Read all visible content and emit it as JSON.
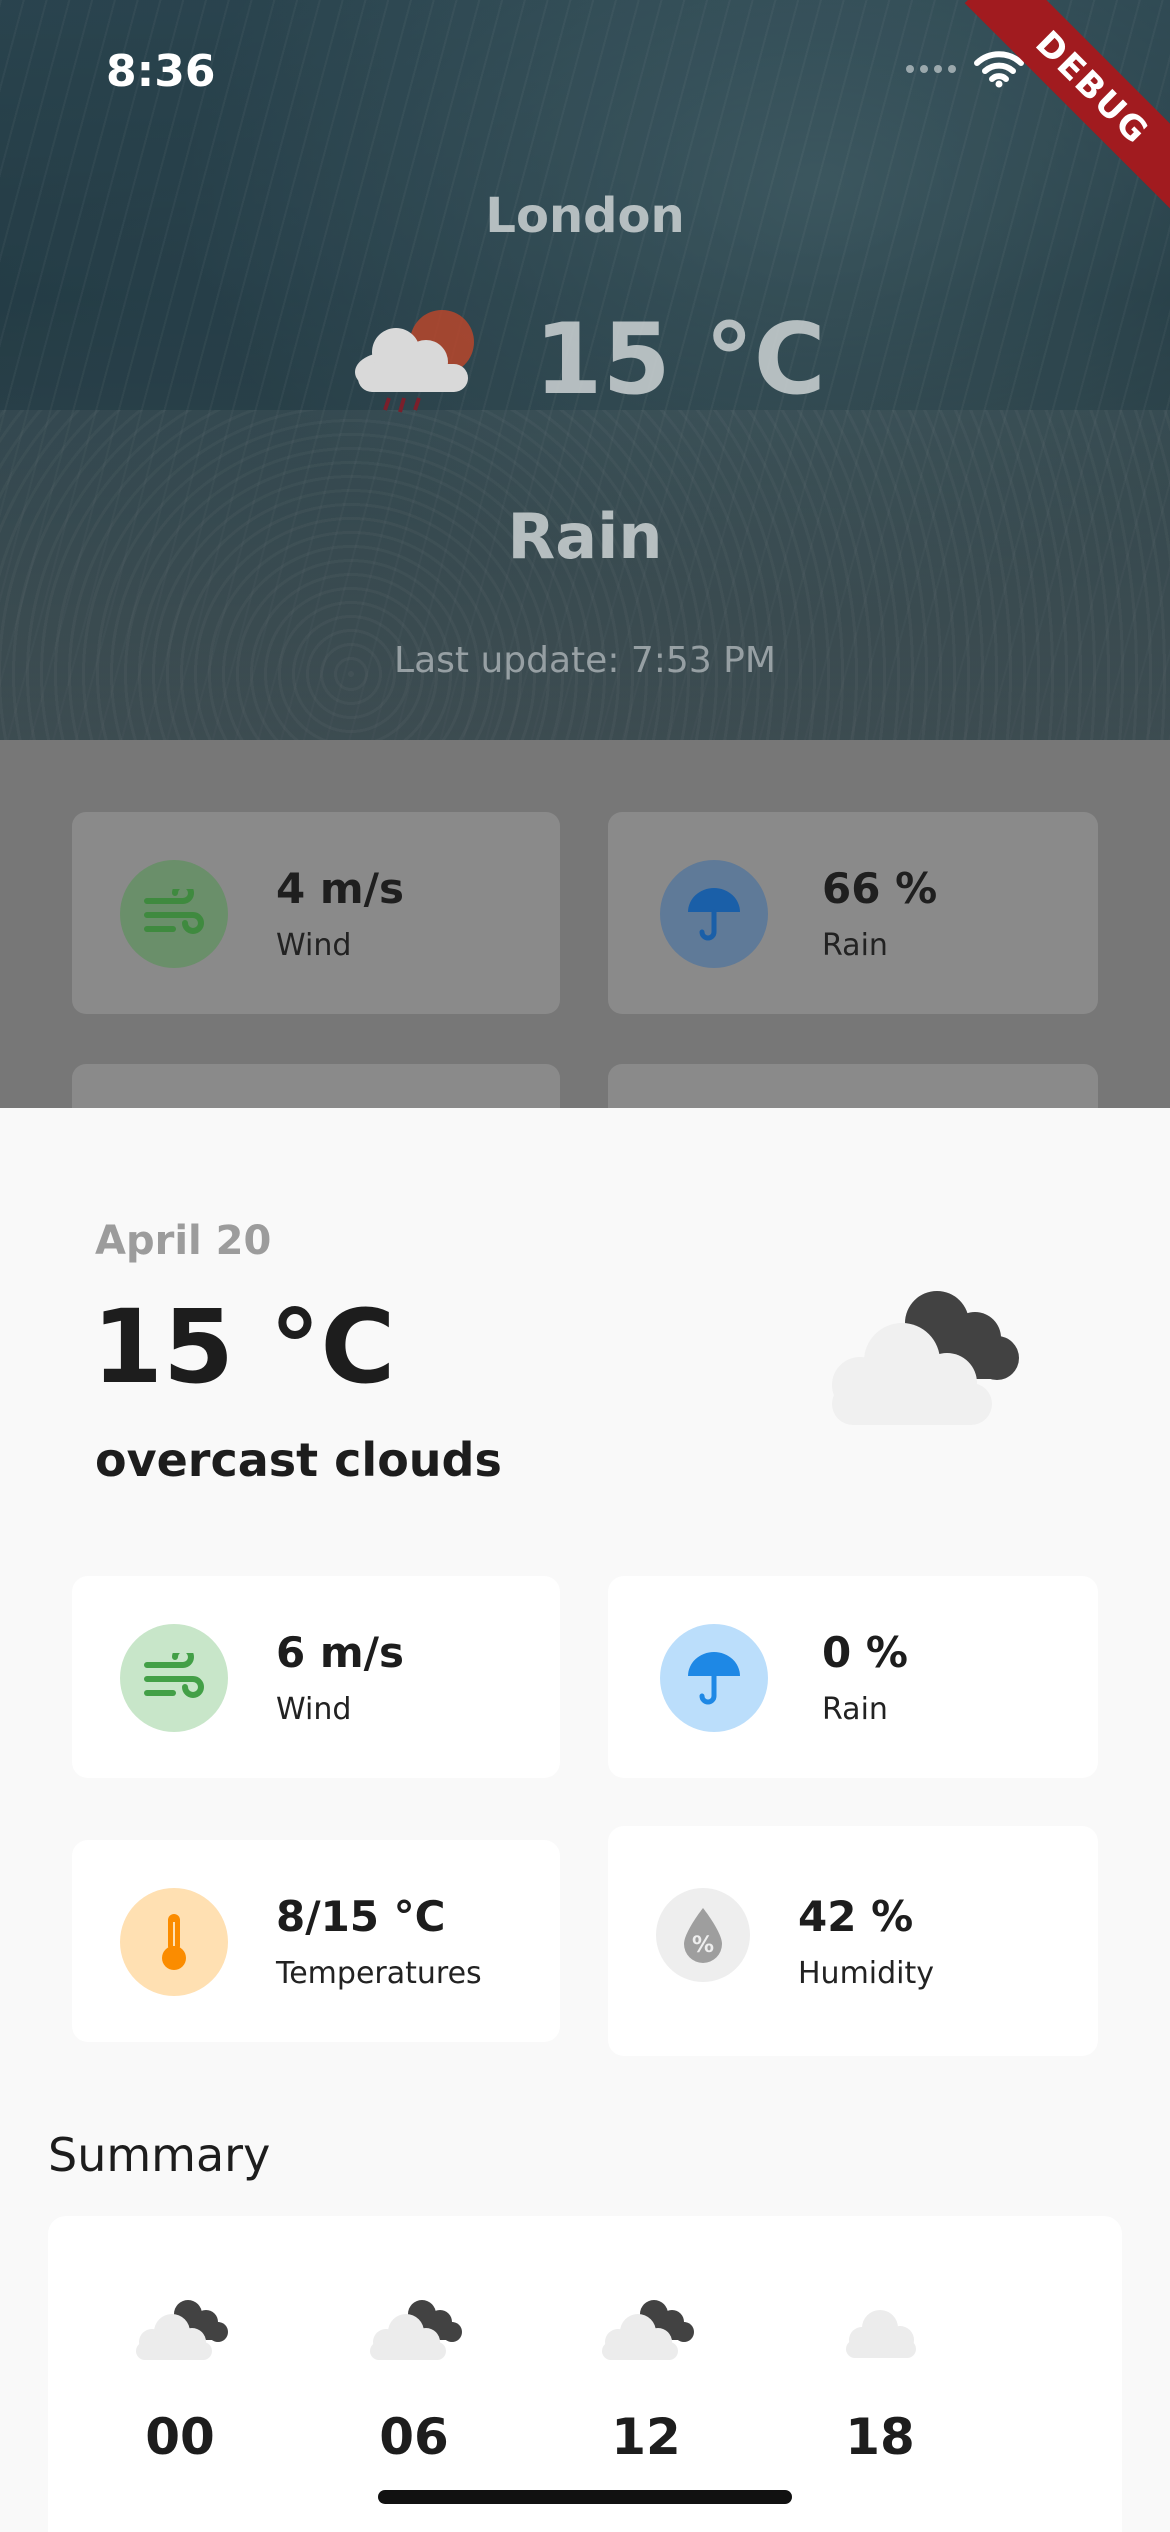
{
  "status_bar": {
    "time": "8:36"
  },
  "debug_banner": "DEBUG",
  "current": {
    "city": "London",
    "temperature": "15 °C",
    "condition": "Rain",
    "last_update": "Last update: 7:53 PM",
    "cards": [
      {
        "value": "4 m/s",
        "label": "Wind",
        "icon": "wind-icon"
      },
      {
        "value": "66 %",
        "label": "Rain",
        "icon": "umbrella-icon"
      }
    ]
  },
  "sheet": {
    "date": "April 20",
    "temperature": "15 °C",
    "description": "overcast clouds",
    "icon": "overcast-clouds-icon",
    "cards": [
      {
        "value": "6 m/s",
        "label": "Wind",
        "icon": "wind-icon"
      },
      {
        "value": "0 %",
        "label": "Rain",
        "icon": "umbrella-icon"
      },
      {
        "value": "8/15 °C",
        "label": "Temperatures",
        "icon": "thermometer-icon"
      },
      {
        "value": "42 %",
        "label": "Humidity",
        "icon": "humidity-icon"
      }
    ],
    "summary_title": "Summary",
    "hours": [
      {
        "hour": "00",
        "icon": "overcast-clouds-icon"
      },
      {
        "hour": "06",
        "icon": "overcast-clouds-icon"
      },
      {
        "hour": "12",
        "icon": "overcast-clouds-icon"
      },
      {
        "hour": "18",
        "icon": "cloud-icon"
      }
    ]
  },
  "colors": {
    "wind": "#43a047",
    "wind_bg": "#c8e6c9",
    "rain": "#1e88e5",
    "rain_bg": "#bbdefb",
    "temp": "#fb8c00",
    "temp_bg": "#ffe0b2",
    "humidity": "#9e9e9e",
    "humidity_bg": "#eeeeee"
  }
}
